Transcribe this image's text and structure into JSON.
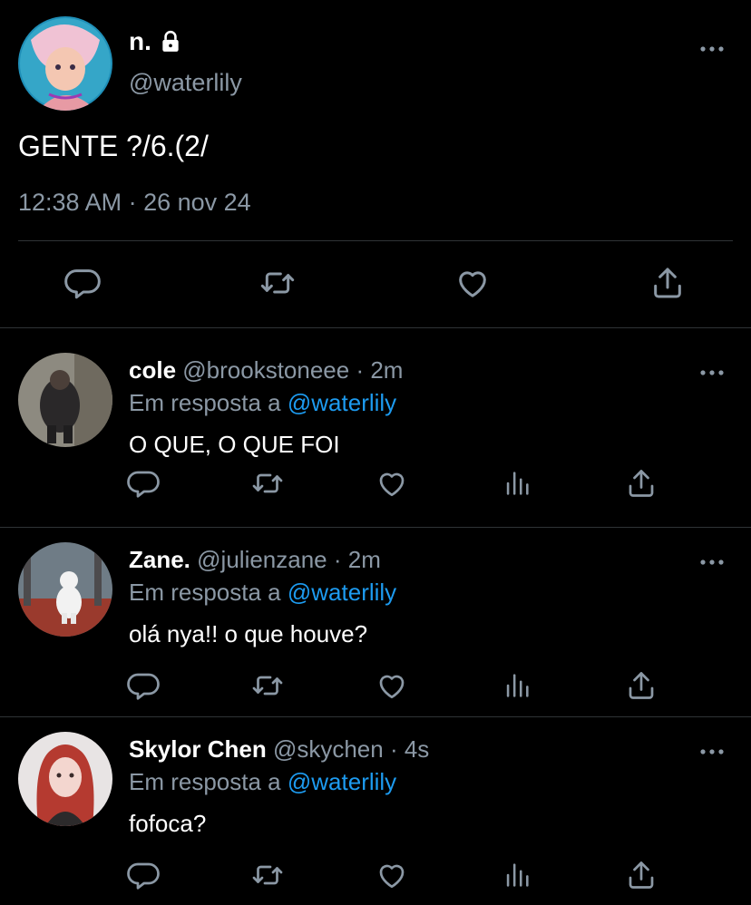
{
  "main": {
    "name": "n.",
    "handle": "@waterlily",
    "text": "GENTE ?/6.(2/",
    "meta": "12:38 AM · 26 nov 24"
  },
  "replies": [
    {
      "name": "cole",
      "handle": "@brookstoneee",
      "time": "· 2m",
      "reply_prefix": "Em resposta a",
      "reply_to": "@waterlily",
      "text": "O QUE, O QUE FOI"
    },
    {
      "name": "Zane.",
      "handle": "@julienzane",
      "time": "· 2m",
      "reply_prefix": "Em resposta a",
      "reply_to": "@waterlily",
      "text": "olá nya!! o que houve?"
    },
    {
      "name": "Skylor Chen",
      "handle": "@skychen",
      "time": "· 4s",
      "reply_prefix": "Em resposta a",
      "reply_to": "@waterlily",
      "text": "fofoca?"
    }
  ],
  "icons": {
    "reply": "reply-icon",
    "retweet": "retweet-icon",
    "like": "heart-icon",
    "views": "views-icon",
    "share": "share-icon",
    "more": "more-icon",
    "lock": "lock-icon"
  },
  "colors": {
    "background": "#000000",
    "text": "#ffffff",
    "secondary": "#8b98a5",
    "link": "#1d9bf0",
    "divider": "#2f3336"
  }
}
